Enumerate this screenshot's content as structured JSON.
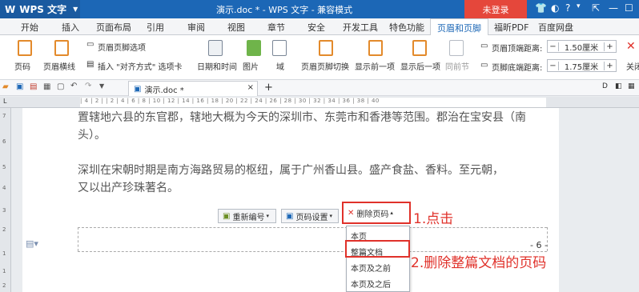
{
  "titlebar": {
    "app_name": "WPS 文字",
    "doc_title": "演示.doc * - WPS 文字 - 兼容模式",
    "login": "未登录",
    "help": "?"
  },
  "menu_tabs": [
    "开始",
    "插入",
    "页面布局",
    "引用",
    "审阅",
    "视图",
    "章节",
    "安全",
    "开发工具",
    "特色功能",
    "页眉和页脚",
    "福昕PDF",
    "百度网盘"
  ],
  "active_tab": "页眉和页脚",
  "ribbon": {
    "page_number": "页码",
    "header_line": "页眉横线",
    "header_footer_options": "页眉页脚选项",
    "insert_align_tab": "插入 \"对齐方式\" 选项卡",
    "date_time": "日期和时间",
    "picture": "图片",
    "field": "域",
    "switch": "页眉页脚切换",
    "show_prev": "显示前一项",
    "show_next": "显示后一项",
    "same_prev": "同前节",
    "header_top_label": "页眉顶端距离:",
    "header_top_value": "1.50厘米",
    "footer_bottom_label": "页脚底端距离:",
    "footer_bottom_value": "1.75厘米",
    "close": "关闭"
  },
  "doc_tab": {
    "name": "演示.doc *",
    "close": "×",
    "add": "+"
  },
  "ruler_text": "| 4 | 2 |   | 2 | 4 | 6 | 8 | 10 | 12 | 14 | 16 | 18 | 20 | 22 | 24 | 26 | 28 | 30 | 32 | 34 | 36 | 38 | 40",
  "vruler": [
    "7",
    "6",
    "5",
    "4",
    "3",
    "2",
    "1",
    "1",
    "2"
  ],
  "document": {
    "line1": "置辖地六县的东官郡，辖地大概为今天的深圳市、东莞市和香港等范围。郡治在宝安县（南",
    "line2": "头）。",
    "line3": "深圳在宋朝时期是南方海路贸易的枢纽，属于广州香山县。盛产食盐、香料。至元朝，",
    "line4": "又以出产珍珠著名。"
  },
  "footer_toolbar": {
    "renumber": "重新编号",
    "page_settings": "页码设置",
    "delete_page_number": "删除页码"
  },
  "delete_menu": [
    "本页",
    "整篇文档",
    "本页及之前",
    "本页及之后"
  ],
  "page_number_text": "- 6 -",
  "annotations": {
    "step1": "1.点击",
    "step2": "2.删除整篇文档的页码"
  },
  "colors": {
    "title_blue": "#1c67b6",
    "annotation_red": "#e0312a"
  }
}
